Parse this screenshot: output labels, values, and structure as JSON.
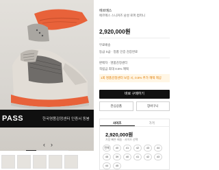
{
  "banner": {
    "logo": "PASS",
    "text": "한국명품감정센터 인증서 동봉"
  },
  "slider": {
    "prev": "‹",
    "next": "›",
    "progress_fraction": 0.24
  },
  "product": {
    "brand": "에르메스",
    "name": "에르메스 스니커즈 남성 로퍼 컴퍼니",
    "price": "2,920,000원"
  },
  "details": {
    "row1": "무료배송",
    "row2": "등급 S급 · 정품 인증 검증완료",
    "row3": "판매자 · 명품감정센터",
    "row4": "적립금 최대 0.5% 혜택"
  },
  "notice": "1회 명품감정센터 보증 시, 0.5% 추가 혜택 제공",
  "actions": {
    "buy_label": "바로 구매하기",
    "wishlist_label": "관심상품",
    "cart_label": "장바구니"
  },
  "size_panel": {
    "tabs": [
      "사이즈",
      "가격"
    ],
    "price": "2,920,000원",
    "sub": "가장 빠른 배송 · 사이즈 선택",
    "sizes": [
      "전체",
      "40",
      "41",
      "42",
      "43",
      "44",
      "45",
      "39",
      "40",
      "41",
      "42",
      "43",
      "44",
      "45"
    ]
  },
  "colors": {
    "sole_orange": "#e8623a",
    "upper_grey": "#8d8a86",
    "banner_bg": "#101010"
  }
}
